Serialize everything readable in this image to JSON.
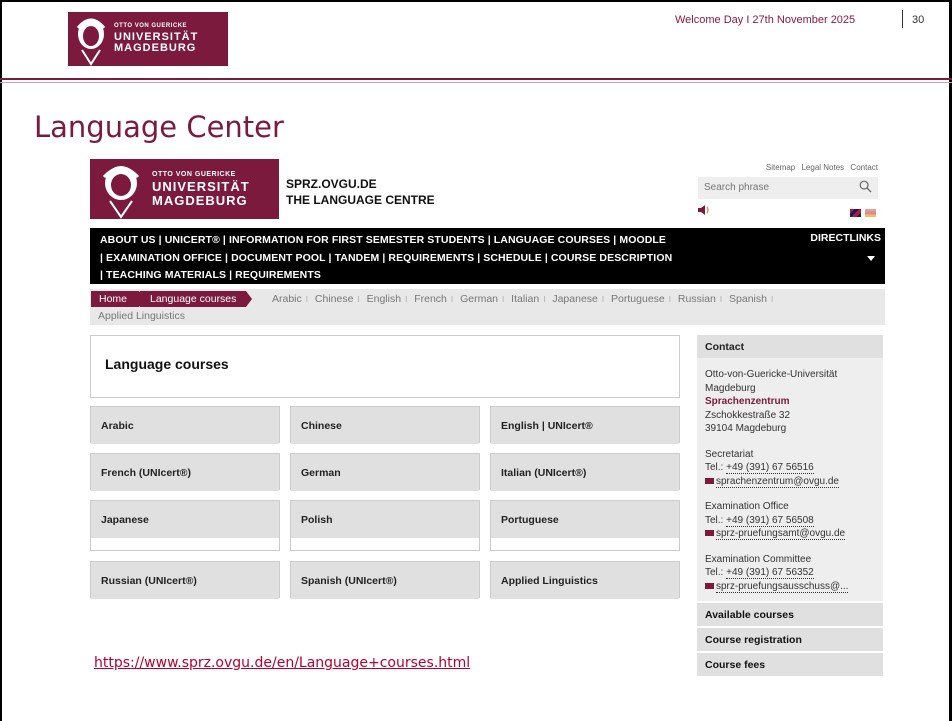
{
  "slide": {
    "logo": {
      "line1": "OTTO VON GUERICKE",
      "line2": "UNIVERSITÄT",
      "line3": "MAGDEBURG"
    },
    "date_text": "Welcome Day I 27th November 2025",
    "page_number": "30",
    "title": "Language Center",
    "url": "https://www.sprz.ovgu.de/en/Language+courses.html"
  },
  "site": {
    "logo": {
      "line1": "OTTO VON GUERICKE",
      "line2": "UNIVERSITÄT",
      "line3": "MAGDEBURG"
    },
    "brand_line1": "SPRZ.OVGU.DE",
    "brand_line2": "THE LANGUAGE CENTRE",
    "util_links": [
      "Sitemap",
      "Legal Notes",
      "Contact"
    ],
    "search_placeholder": "Search phrase",
    "nav_line1": "ABOUT US | UNICERT® | INFORMATION FOR FIRST SEMESTER STUDENTS | LANGUAGE COURSES | MOODLE",
    "nav_line2": "| EXAMINATION OFFICE | DOCUMENT POOL | TANDEM | REQUIREMENTS | SCHEDULE | COURSE DESCRIPTION",
    "nav_line3": "| TEACHING MATERIALS | REQUIREMENTS",
    "directlinks": "DIRECTLINKS",
    "breadcrumb": {
      "home": "Home",
      "current": "Language courses",
      "items": [
        "Arabic",
        "Chinese",
        "English",
        "French",
        "German",
        "Italian",
        "Japanese",
        "Portuguese",
        "Russian",
        "Spanish"
      ],
      "line2": "Applied Linguistics"
    },
    "panel_title": "Language courses",
    "tiles": [
      "Arabic",
      "Chinese",
      "English | UNIcert®",
      "French (UNIcert®)",
      "German",
      "Italian (UNIcert®)",
      "Japanese",
      "Polish",
      "Portuguese",
      "Russian (UNIcert®)",
      "Spanish (UNIcert®)",
      "Applied Linguistics"
    ],
    "sidebar": {
      "head": "Contact",
      "uni_line1": "Otto-von-Guericke-Universität",
      "uni_line2": "Magdeburg",
      "dept": "Sprachenzentrum",
      "street": "Zschokkestraße 32",
      "city": "39104 Magdeburg",
      "secretariat": "Secretariat",
      "sec_tel_label": "Tel.:",
      "sec_tel": "+49 (391) 67 56516",
      "sec_mail": "sprachenzentrum@ovgu.de",
      "exam_office": "Examination Office",
      "exam_tel_label": "Tel.:",
      "exam_tel": "+49 (391) 67 56508",
      "exam_mail": "sprz-pruefungsamt@ovgu.de",
      "exam_committee": "Examination Committee",
      "comm_tel_label": "Tel.:",
      "comm_tel": "+49 (391) 67 56352",
      "comm_mail": "sprz-pruefungsausschuss@...",
      "buttons": [
        "Available courses",
        "Course registration",
        "Course fees"
      ]
    }
  }
}
